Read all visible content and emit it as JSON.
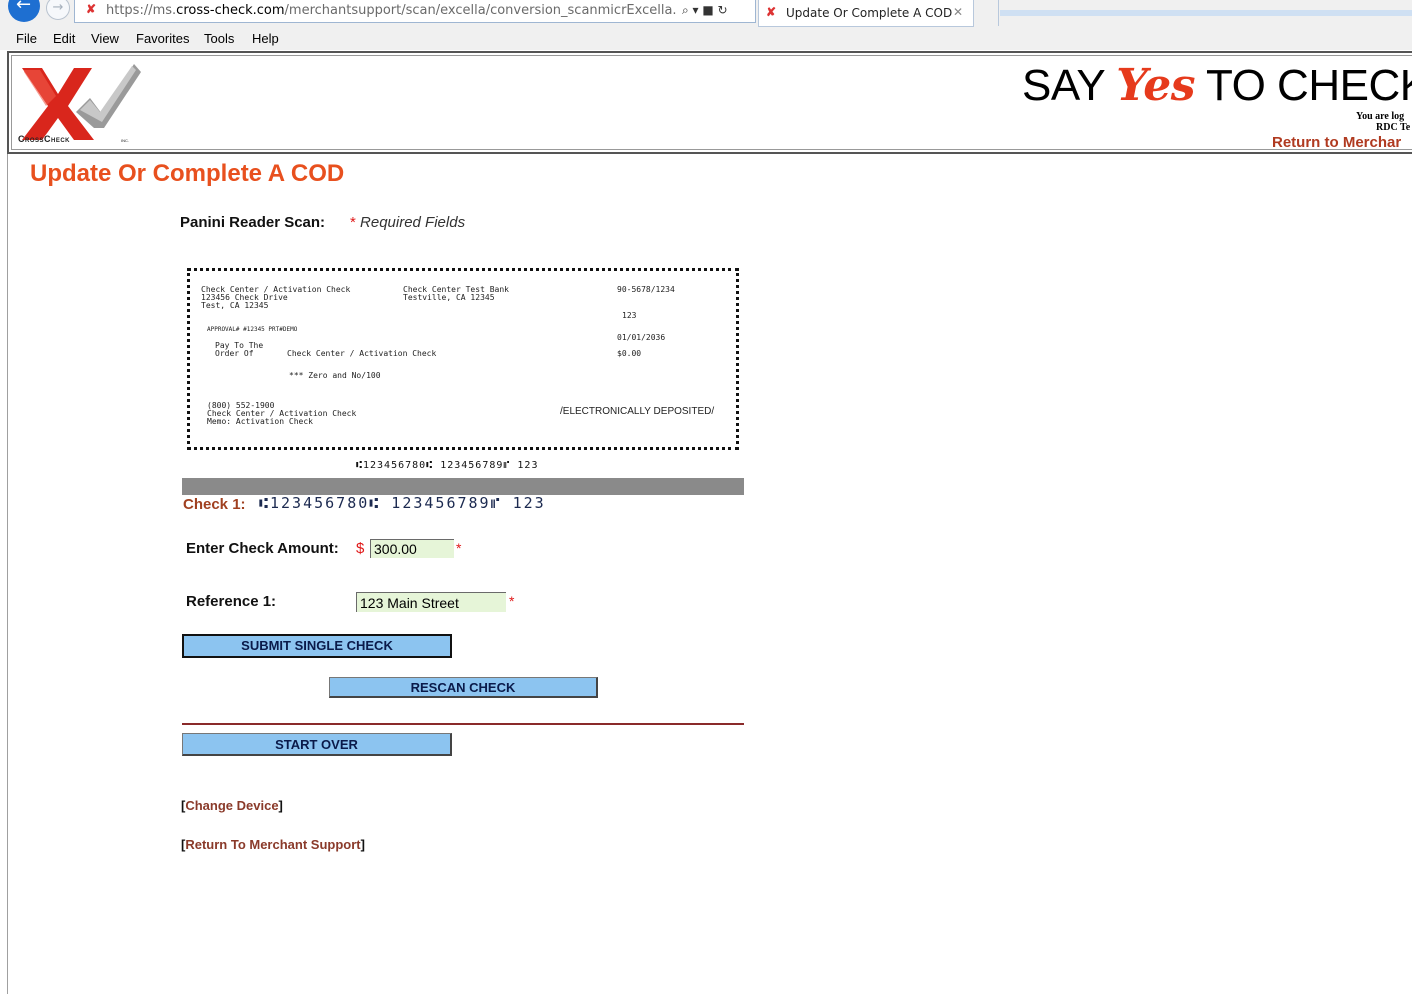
{
  "browser": {
    "url_prefix": "https://ms.",
    "url_domain": "cross-check.com",
    "url_path": "/merchantsupport/scan/excella/conversion_scanmicrExcella.asp?Referer",
    "addr_tools": "⌕ ▾ ■ ↻",
    "tab_title": "Update Or Complete A COD",
    "tab_close": "✕",
    "back_glyph": "←",
    "forward_glyph": "→"
  },
  "menu": [
    "File",
    "Edit",
    "View",
    "Favorites",
    "Tools",
    "Help"
  ],
  "header": {
    "logo_text": "CrossCheck",
    "logo_suffix": "INC.",
    "slogan_pre": "SAY",
    "slogan_yes": "Yes",
    "slogan_post": "TO CHECK",
    "logged_line1": "You are log",
    "logged_line2": "RDC Te",
    "return_link": "Return to Merchar"
  },
  "page": {
    "title": "Update Or Complete A COD",
    "scan_label": "Panini Reader Scan:",
    "required_star": "*",
    "required_note": "Required Fields"
  },
  "check_image": {
    "payer_line1": "Check Center / Activation Check",
    "payer_line2": "123456  Check Drive",
    "payer_line3": "Test, CA 12345",
    "bank_line1": "Check Center Test Bank",
    "bank_line2": "Testville, CA 12345",
    "routing_fraction": "90-5678/1234",
    "check_number": "123",
    "approval": "APPROVAL#  #12345  PRT#DEMO",
    "date": "01/01/2036",
    "pay_to_line1": "Pay To The",
    "pay_to_line2": "Order Of",
    "payee": "Check Center / Activation Check",
    "amount": "$0.00",
    "written_amount": "***  Zero and No/100",
    "phone": "(800) 552-1900",
    "footer_name": "Check Center / Activation Check",
    "memo": "Memo: Activation Check",
    "stamp": "/ELECTRONICALLY DEPOSITED/",
    "micr_line": "⑆123456780⑆ 123456789⑈ 123"
  },
  "check1": {
    "label": "Check 1:",
    "micr": "⑆123456780⑆ 123456789⑈ 123"
  },
  "form": {
    "amount_label": "Enter Check Amount:",
    "dollar_sign": "$",
    "amount_value": "300.00",
    "amount_star": "*",
    "reference_label": "Reference 1:",
    "reference_value": "123 Main Street",
    "reference_star": "*"
  },
  "buttons": {
    "submit": "SUBMIT SINGLE CHECK",
    "rescan": "RESCAN CHECK",
    "start_over": "START OVER"
  },
  "links": {
    "open_bracket": "[",
    "close_bracket": "]",
    "change_device": "Change Device",
    "return_support": "Return To Merchant Support"
  },
  "colors": {
    "title_orange": "#e8501e",
    "button_blue": "#8cc4f0",
    "required_red": "#e01818",
    "input_green": "#e6f5d8"
  }
}
